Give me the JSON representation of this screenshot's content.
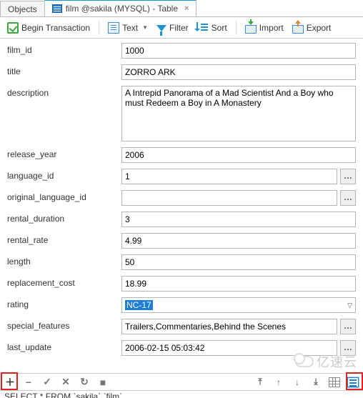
{
  "tabs": {
    "objects": "Objects",
    "active": "film @sakila (MYSQL) - Table"
  },
  "toolbar": {
    "begin": "Begin Transaction",
    "text": "Text",
    "filter": "Filter",
    "sort": "Sort",
    "import": "Import",
    "export": "Export"
  },
  "form": {
    "film_id": {
      "label": "film_id",
      "value": "1000"
    },
    "title": {
      "label": "title",
      "value": "ZORRO ARK"
    },
    "description": {
      "label": "description",
      "value": "A Intrepid Panorama of a Mad Scientist And a Boy who must Redeem a Boy in A Monastery"
    },
    "release_year": {
      "label": "release_year",
      "value": "2006"
    },
    "language_id": {
      "label": "language_id",
      "value": "1"
    },
    "original_language_id": {
      "label": "original_language_id",
      "value": ""
    },
    "rental_duration": {
      "label": "rental_duration",
      "value": "3"
    },
    "rental_rate": {
      "label": "rental_rate",
      "value": "4.99"
    },
    "length": {
      "label": "length",
      "value": "50"
    },
    "replacement_cost": {
      "label": "replacement_cost",
      "value": "18.99"
    },
    "rating": {
      "label": "rating",
      "value": "NC-17"
    },
    "special_features": {
      "label": "special_features",
      "value": "Trailers,Commentaries,Behind the Scenes"
    },
    "last_update": {
      "label": "last_update",
      "value": "2006-02-15 05:03:42"
    }
  },
  "sql": "SELECT * FROM `sakila`.`film`",
  "watermark": "亿速云"
}
